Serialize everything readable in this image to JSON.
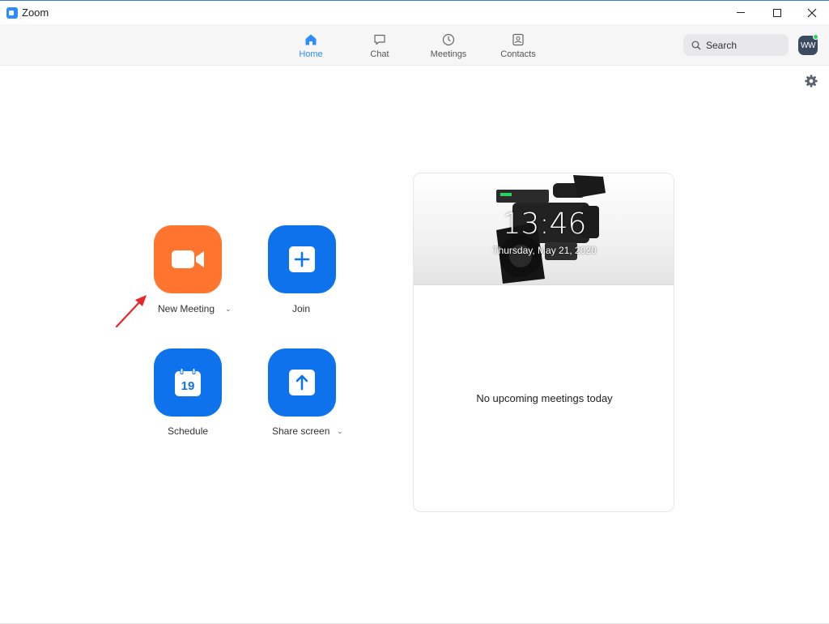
{
  "window": {
    "title": "Zoom",
    "controls": [
      "minimize",
      "maximize",
      "close"
    ]
  },
  "nav": {
    "tabs": [
      {
        "label": "Home",
        "icon": "home-icon",
        "active": true
      },
      {
        "label": "Chat",
        "icon": "chat-bubble-icon",
        "active": false
      },
      {
        "label": "Meetings",
        "icon": "clock-icon",
        "active": false
      },
      {
        "label": "Contacts",
        "icon": "contact-card-icon",
        "active": false
      }
    ],
    "search_label": "Search",
    "avatar_initials": "WW",
    "presence_color": "#23d959"
  },
  "actions": {
    "new_meeting": {
      "label": "New Meeting",
      "color": "#ff742e",
      "icon": "video-camera-icon"
    },
    "join": {
      "label": "Join",
      "color": "#0e72ed",
      "icon": "plus-icon"
    },
    "schedule": {
      "label": "Schedule",
      "color": "#0e72ed",
      "icon": "calendar-icon",
      "day": "19"
    },
    "share_screen": {
      "label": "Share screen",
      "color": "#0e72ed",
      "icon": "upload-arrow-icon"
    }
  },
  "meetings_panel": {
    "time": "13:46",
    "date": "Thursday, May 21, 2020",
    "empty_message": "No upcoming meetings today"
  },
  "colors": {
    "accent": "#2d8cff",
    "annotation": "#e8262b"
  }
}
